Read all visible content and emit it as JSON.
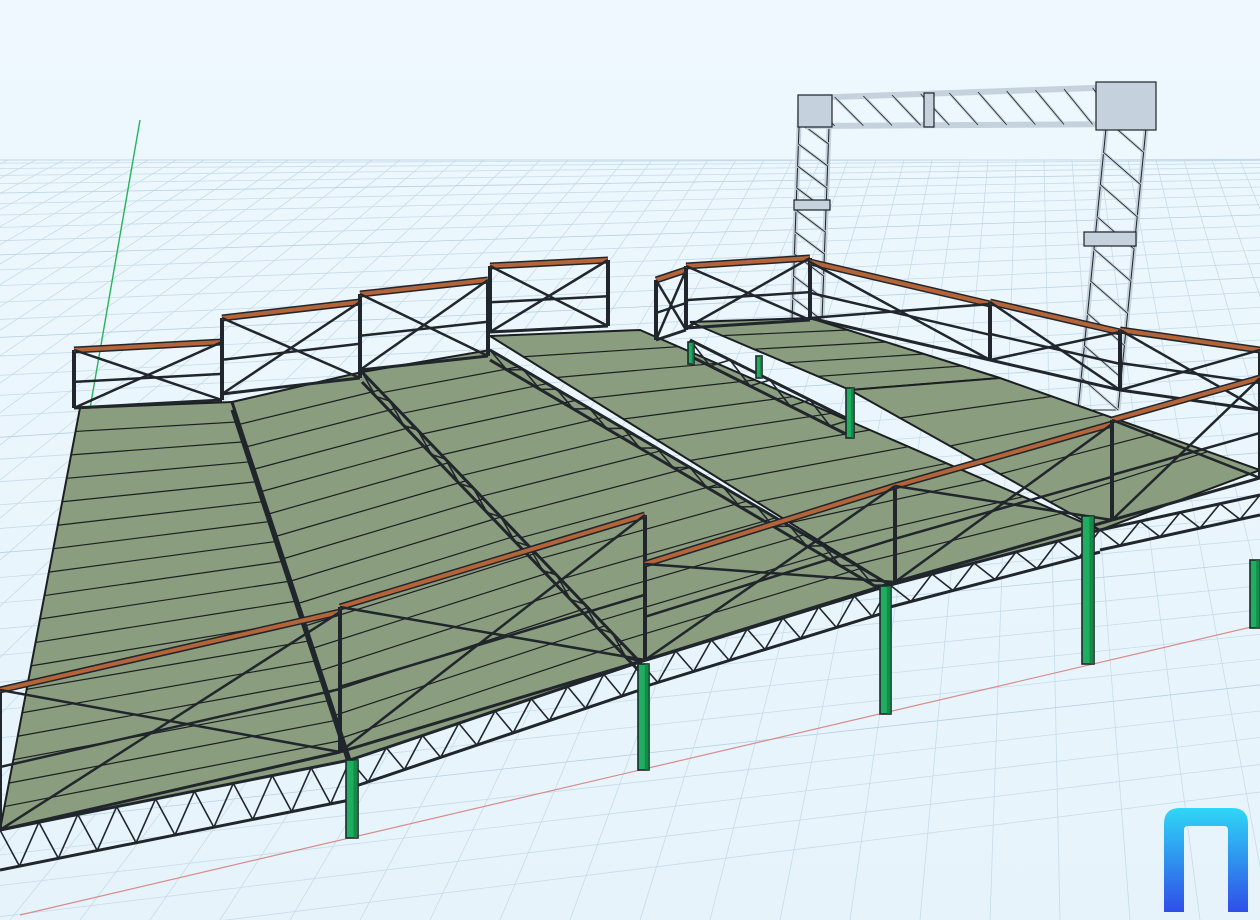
{
  "app": {
    "colors": {
      "background": "#eaf5fc",
      "grid": "#c6dcea",
      "grid_major": "#b7d1e2",
      "deck": "#8b9d7f",
      "deck_edge": "#1b1f22",
      "frame": "#20262b",
      "handrail_top": "#b5643a",
      "leg": "#1fae5f",
      "leg_dark": "#137a40",
      "truss": "#c5d1dc",
      "truss_dark": "#1d2328",
      "axis_y": "#27b35a",
      "axis_x": "#d88c8c",
      "logo_gradient_top": "#2fd7f6",
      "logo_gradient_bottom": "#2f4ee8"
    },
    "icons": {
      "logo": "brand-logo-icon",
      "y_axis": "y-axis-guide",
      "x_axis": "x-axis-guide"
    }
  }
}
